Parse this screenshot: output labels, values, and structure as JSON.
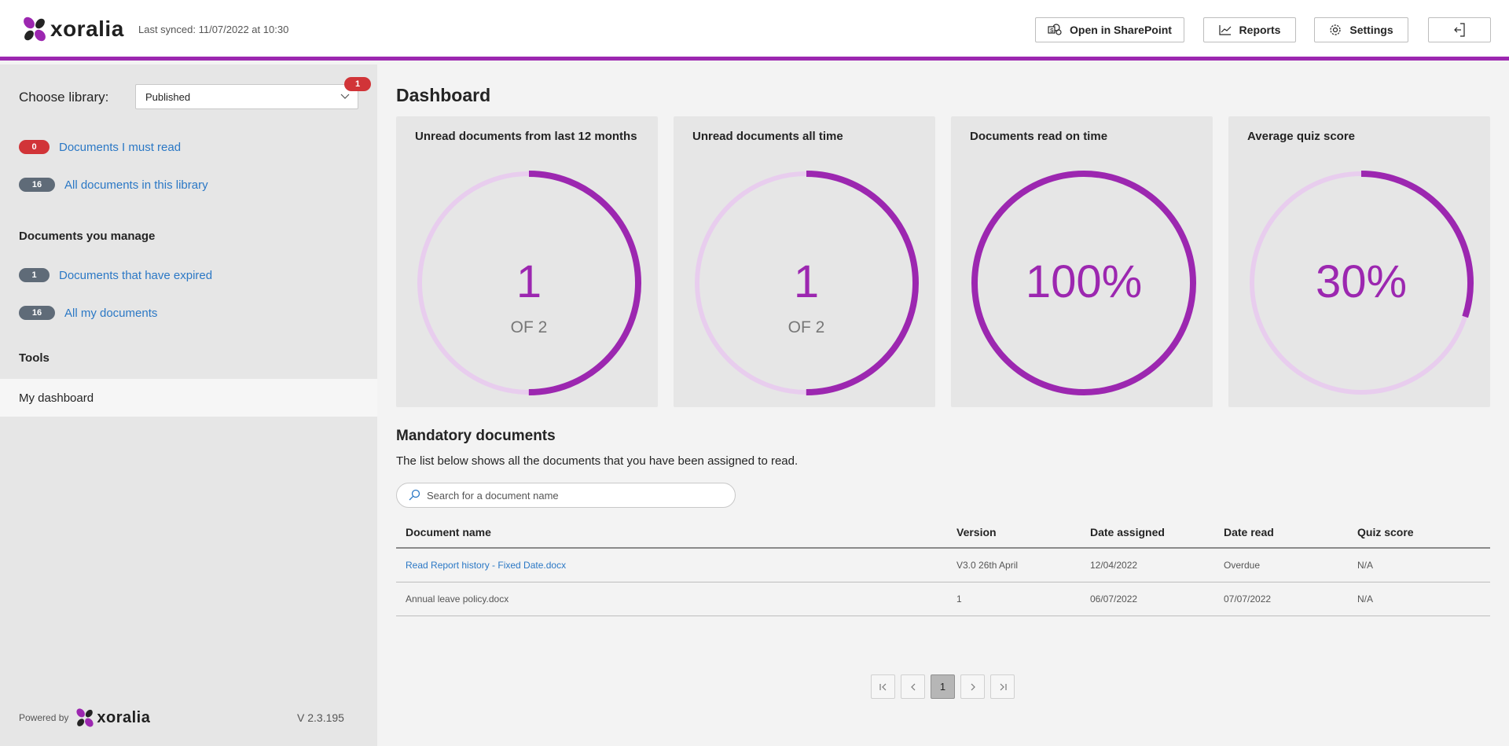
{
  "header": {
    "brand": "xoralia",
    "sync": "Last synced: 11/07/2022 at 10:30",
    "buttons": {
      "sharepoint": "Open in SharePoint",
      "reports": "Reports",
      "settings": "Settings"
    },
    "colors": {
      "accent": "#9c27b0"
    }
  },
  "sidebar": {
    "library_label": "Choose library:",
    "library_value": "Published",
    "library_badge": "1",
    "items": [
      {
        "count": "0",
        "label": "Documents I must read"
      },
      {
        "count": "16",
        "label": "All documents in this library"
      }
    ],
    "manage_heading": "Documents you manage",
    "manage_items": [
      {
        "count": "1",
        "label": "Documents that have expired"
      },
      {
        "count": "16",
        "label": "All my documents"
      }
    ],
    "tools_heading": "Tools",
    "tools_active": "My dashboard",
    "powered_by": "Powered by",
    "version": "V 2.3.195"
  },
  "dashboard": {
    "title": "Dashboard",
    "cards": [
      {
        "title": "Unread documents from last 12 months",
        "value": "1",
        "sub": "OF 2",
        "progress": 0.5
      },
      {
        "title": "Unread documents all time",
        "value": "1",
        "sub": "OF 2",
        "progress": 0.5
      },
      {
        "title": "Documents read on time",
        "value": "100%",
        "sub": "",
        "progress": 1.0
      },
      {
        "title": "Average quiz score",
        "value": "30%",
        "sub": "",
        "progress": 0.3
      }
    ]
  },
  "mandatory": {
    "title": "Mandatory documents",
    "description": "The list below shows all the documents that you have been assigned to read.",
    "search_placeholder": "Search for a document name",
    "columns": [
      "Document name",
      "Version",
      "Date assigned",
      "Date read",
      "Quiz score"
    ],
    "rows": [
      {
        "name": "Read Report history - Fixed Date.docx",
        "version": "V3.0 26th April",
        "assigned": "12/04/2022",
        "read": "Overdue",
        "quiz": "N/A"
      },
      {
        "name": "Annual leave policy.docx",
        "version": "1",
        "assigned": "06/07/2022",
        "read": "07/07/2022",
        "quiz": "N/A"
      }
    ],
    "pagination": {
      "current": "1"
    }
  }
}
